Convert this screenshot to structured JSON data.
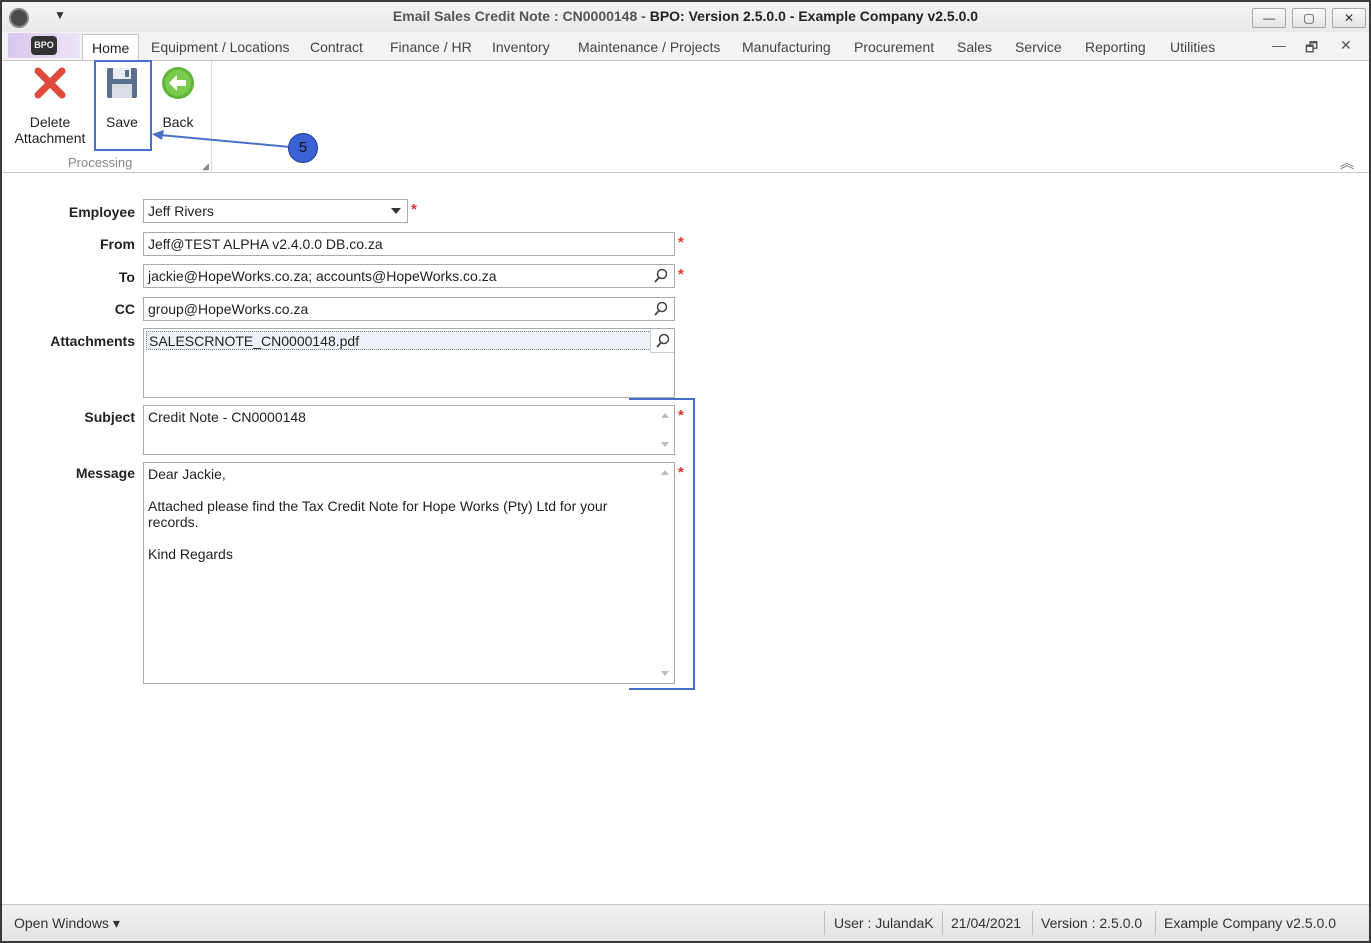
{
  "window": {
    "title_prefix": "Email Sales Credit Note : CN0000148 - ",
    "title_main": "BPO: Version 2.5.0.0 - Example Company v2.5.0.0",
    "qat_arrow": "▼",
    "minimize": "—",
    "maximize": "▢",
    "close": "✕"
  },
  "logo": {
    "text": "BPO"
  },
  "tabs": [
    {
      "label": "Home"
    },
    {
      "label": "Equipment / Locations"
    },
    {
      "label": "Contract"
    },
    {
      "label": "Finance / HR"
    },
    {
      "label": "Inventory"
    },
    {
      "label": "Maintenance / Projects"
    },
    {
      "label": "Manufacturing"
    },
    {
      "label": "Procurement"
    },
    {
      "label": "Sales"
    },
    {
      "label": "Service"
    },
    {
      "label": "Reporting"
    },
    {
      "label": "Utilities"
    }
  ],
  "mdi": {
    "minimize": "—",
    "restore": "🗗",
    "close": "✕"
  },
  "ribbon": {
    "delete_label_1": "Delete",
    "delete_label_2": "Attachment",
    "save_label": "Save",
    "back_label": "Back",
    "group_label": "Processing",
    "collapse": "︽"
  },
  "callout": {
    "number": "5"
  },
  "form": {
    "employee_label": "Employee",
    "employee_value": "Jeff Rivers",
    "from_label": "From",
    "from_value": "Jeff@TEST ALPHA v2.4.0.0 DB.co.za",
    "to_label": "To",
    "to_value": "jackie@HopeWorks.co.za; accounts@HopeWorks.co.za",
    "cc_label": "CC",
    "cc_value": "group@HopeWorks.co.za",
    "attachments_label": "Attachments",
    "attachment_file": "SALESCRNOTE_CN0000148.pdf",
    "subject_label": "Subject",
    "subject_value": "Credit Note - CN0000148",
    "message_label": "Message",
    "message_line1": "Dear Jackie,",
    "message_line2": "Attached please find the Tax Credit Note for Hope Works (Pty) Ltd for your",
    "message_line3": "records.",
    "message_line4": "Kind Regards",
    "required_marker": "*"
  },
  "status": {
    "open_windows": "Open Windows ▾",
    "user": "User : JulandaK",
    "date": "21/04/2021",
    "version": "Version : 2.5.0.0",
    "company": "Example Company v2.5.0.0"
  },
  "colors": {
    "annotation_blue": "#4a6fc9",
    "required_red": "#e03030",
    "delete_red": "#e04a3a",
    "back_green": "#5fb53a"
  }
}
